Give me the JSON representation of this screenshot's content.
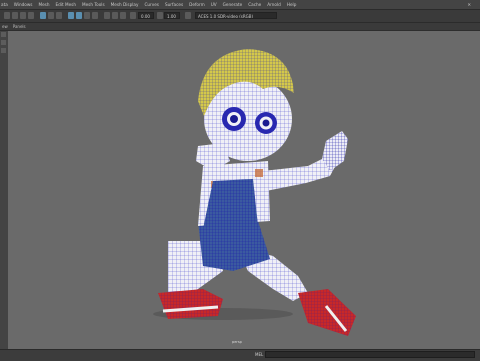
{
  "menubar": {
    "items": [
      "ata",
      "Windows",
      "Mesh",
      "Edit Mesh",
      "Mesh Tools",
      "Mesh Display",
      "Curves",
      "Surfaces",
      "Deform",
      "UV",
      "Generate",
      "Cache",
      "Arnold",
      "Help"
    ],
    "window_button": "✕"
  },
  "toolbar": {
    "field_a": "0.00",
    "field_b": "1.00",
    "colorspace": "ACES 1.0 SDR-video (sRGB)"
  },
  "panel_menu": {
    "items": [
      "ew",
      "Panels"
    ]
  },
  "viewport": {
    "camera_label": "persp"
  },
  "statusbar": {
    "mel_label": "MEL"
  },
  "colors": {
    "hair": "#d4c84a",
    "skin": "#f0f0f6",
    "overalls": "#3b5aa0",
    "shoe_red": "#c82828",
    "wire": "#3030c8",
    "viewport_bg": "#6a6a6a"
  }
}
